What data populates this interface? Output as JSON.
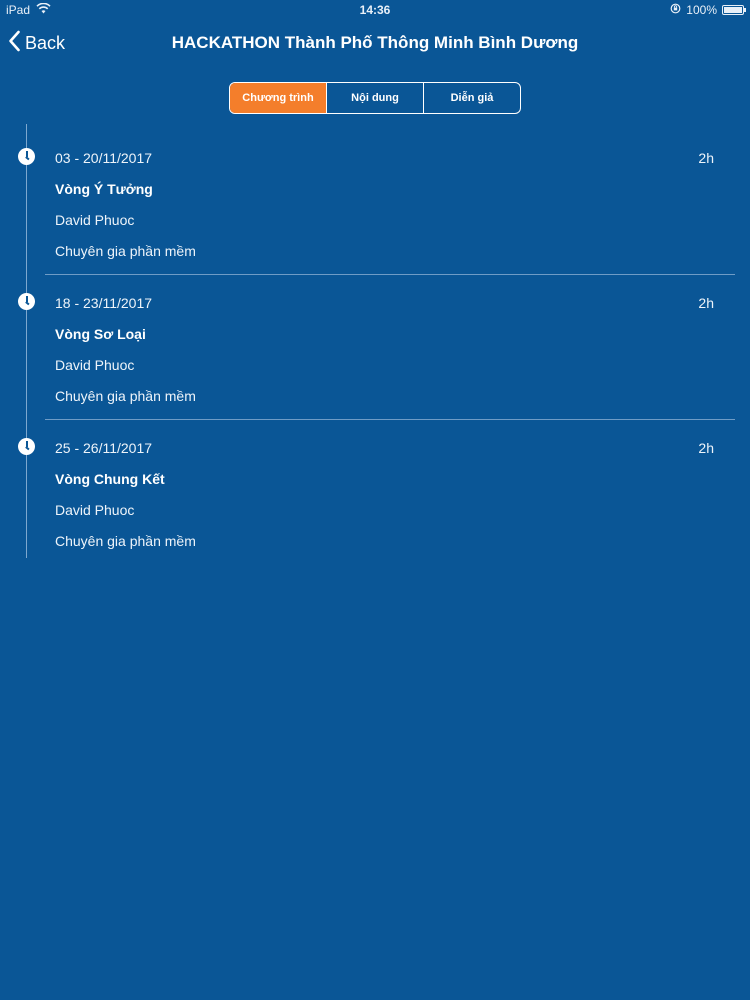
{
  "status_bar": {
    "device": "iPad",
    "time": "14:36",
    "battery": "100%"
  },
  "nav": {
    "back_label": "Back",
    "title": "HACKATHON Thành Phố Thông Minh Bình Dương"
  },
  "tabs": [
    {
      "label": "Chương trình",
      "active": true
    },
    {
      "label": "Nội dung",
      "active": false
    },
    {
      "label": "Diễn giả",
      "active": false
    }
  ],
  "events": [
    {
      "date": "03 - 20/11/2017",
      "duration": "2h",
      "name": "Vòng Ý Tưởng",
      "speaker": "David Phuoc",
      "role": "Chuyên gia phần mềm"
    },
    {
      "date": "18 - 23/11/2017",
      "duration": "2h",
      "name": "Vòng Sơ Loại",
      "speaker": "David Phuoc",
      "role": "Chuyên gia phần mềm"
    },
    {
      "date": "25 - 26/11/2017",
      "duration": "2h",
      "name": "Vòng Chung Kết",
      "speaker": "David Phuoc",
      "role": "Chuyên gia phần mềm"
    }
  ],
  "icons": {
    "wifi": "wifi-icon",
    "back": "chevron-left-icon",
    "clock": "clock-icon",
    "orientation_lock": "orientation-lock-icon",
    "battery": "battery-icon"
  },
  "colors": {
    "background": "#0a5696",
    "active_tab": "#f47e2b",
    "text": "#ffffff"
  }
}
